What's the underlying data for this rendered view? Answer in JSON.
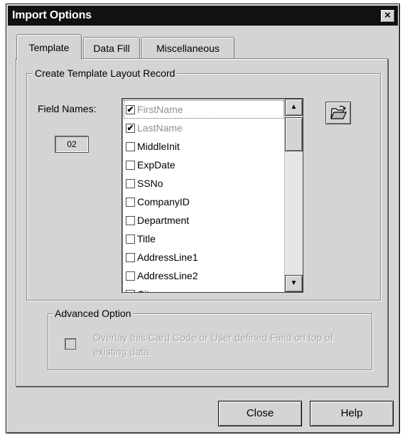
{
  "window": {
    "title": "Import Options",
    "close_glyph": "×"
  },
  "tabs": [
    {
      "label": "Template",
      "active": true
    },
    {
      "label": "Data Fill",
      "active": false
    },
    {
      "label": "Miscellaneous",
      "active": false
    }
  ],
  "template_group": {
    "legend": "Create Template Layout Record",
    "field_names_label": "Field Names:",
    "selected_count": "02",
    "browse_icon": "open-folder-icon",
    "fields": [
      {
        "label": "FirstName",
        "checked": true,
        "grayed": true
      },
      {
        "label": "LastName",
        "checked": true,
        "grayed": true
      },
      {
        "label": "MiddleInit",
        "checked": false,
        "grayed": false
      },
      {
        "label": "ExpDate",
        "checked": false,
        "grayed": false
      },
      {
        "label": "SSNo",
        "checked": false,
        "grayed": false
      },
      {
        "label": "CompanyID",
        "checked": false,
        "grayed": false
      },
      {
        "label": "Department",
        "checked": false,
        "grayed": false
      },
      {
        "label": "Title",
        "checked": false,
        "grayed": false
      },
      {
        "label": "AddressLine1",
        "checked": false,
        "grayed": false
      },
      {
        "label": "AddressLine2",
        "checked": false,
        "grayed": false
      },
      {
        "label": "City",
        "checked": false,
        "grayed": false
      }
    ]
  },
  "advanced_group": {
    "legend": "Advanced Option",
    "checkbox_checked": false,
    "checkbox_text": "Overlay this Card Code or User defined Field on top of existing data."
  },
  "buttons": {
    "close_label": "Close",
    "help_label": "Help"
  },
  "colors": {
    "title_bar": "#111111",
    "dialog_face": "#d4d4d4",
    "disabled_text": "#a8a8a8"
  }
}
